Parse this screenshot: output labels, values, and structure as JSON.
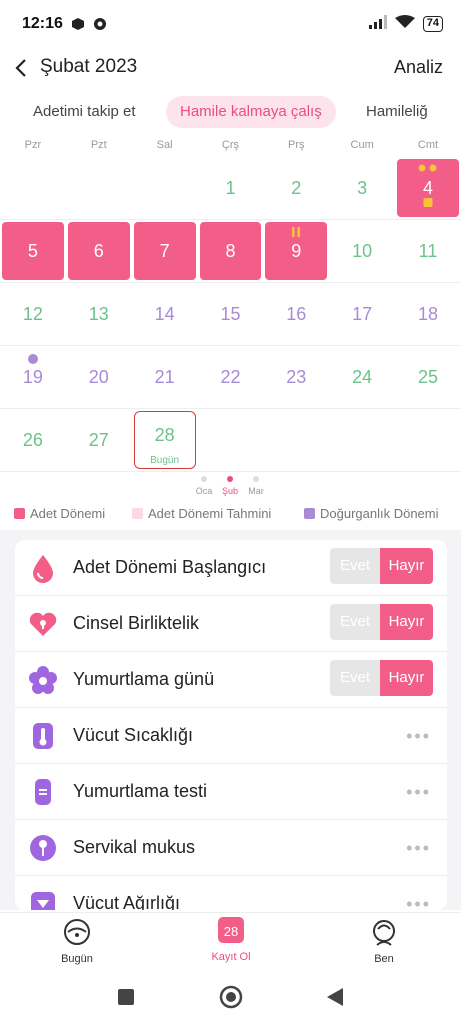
{
  "status_bar": {
    "time": "12:16",
    "battery": "74"
  },
  "header": {
    "title": "Şubat 2023",
    "action": "Analiz"
  },
  "tabs": [
    {
      "label": "Adetimi takip et"
    },
    {
      "label": "Hamile kalmaya çalış"
    },
    {
      "label": "Hamileliğ"
    }
  ],
  "weekdays": [
    "Pzr",
    "Pzt",
    "Sal",
    "Çrş",
    "Prş",
    "Cum",
    "Cmt"
  ],
  "calendar": {
    "w1": [
      "1",
      "2",
      "3",
      "4"
    ],
    "w2": [
      "5",
      "6",
      "7",
      "8",
      "9",
      "10",
      "11"
    ],
    "w3": [
      "12",
      "13",
      "14",
      "15",
      "16",
      "17",
      "18"
    ],
    "w4": [
      "19",
      "20",
      "21",
      "22",
      "23",
      "24",
      "25"
    ],
    "w5": [
      "26",
      "27",
      "28"
    ],
    "today_label": "Bugün"
  },
  "months": [
    "Oca",
    "Şub",
    "Mar"
  ],
  "legend": [
    "Adet Dönemi",
    "Adet Dönemi Tahmini",
    "Doğurganlık Dönemi"
  ],
  "colors": {
    "period": "#f25e88",
    "predicted": "#fbd9e3",
    "fertile": "#a98ad6",
    "green": "#6cc28b"
  },
  "records": [
    {
      "label": "Adet Dönemi Başlangıcı",
      "icon": "drop-icon",
      "yes": "Evet",
      "no": "Hayır"
    },
    {
      "label": "Cinsel Birliktelik",
      "icon": "heart-lock-icon",
      "yes": "Evet",
      "no": "Hayır"
    },
    {
      "label": "Yumurtlama günü",
      "icon": "flower-icon",
      "yes": "Evet",
      "no": "Hayır"
    },
    {
      "label": "Vücut Sıcaklığı",
      "icon": "thermometer-icon"
    },
    {
      "label": "Yumurtlama testi",
      "icon": "test-strip-icon"
    },
    {
      "label": "Servikal mukus",
      "icon": "mucus-icon"
    },
    {
      "label": "Vücut Ağırlığı",
      "icon": "scale-icon"
    }
  ],
  "bottom_nav": [
    {
      "label": "Bugün",
      "icon": "today-icon"
    },
    {
      "label": "Kayıt Ol",
      "icon": "calendar-28-icon",
      "badge": "28"
    },
    {
      "label": "Ben",
      "icon": "profile-icon"
    }
  ]
}
